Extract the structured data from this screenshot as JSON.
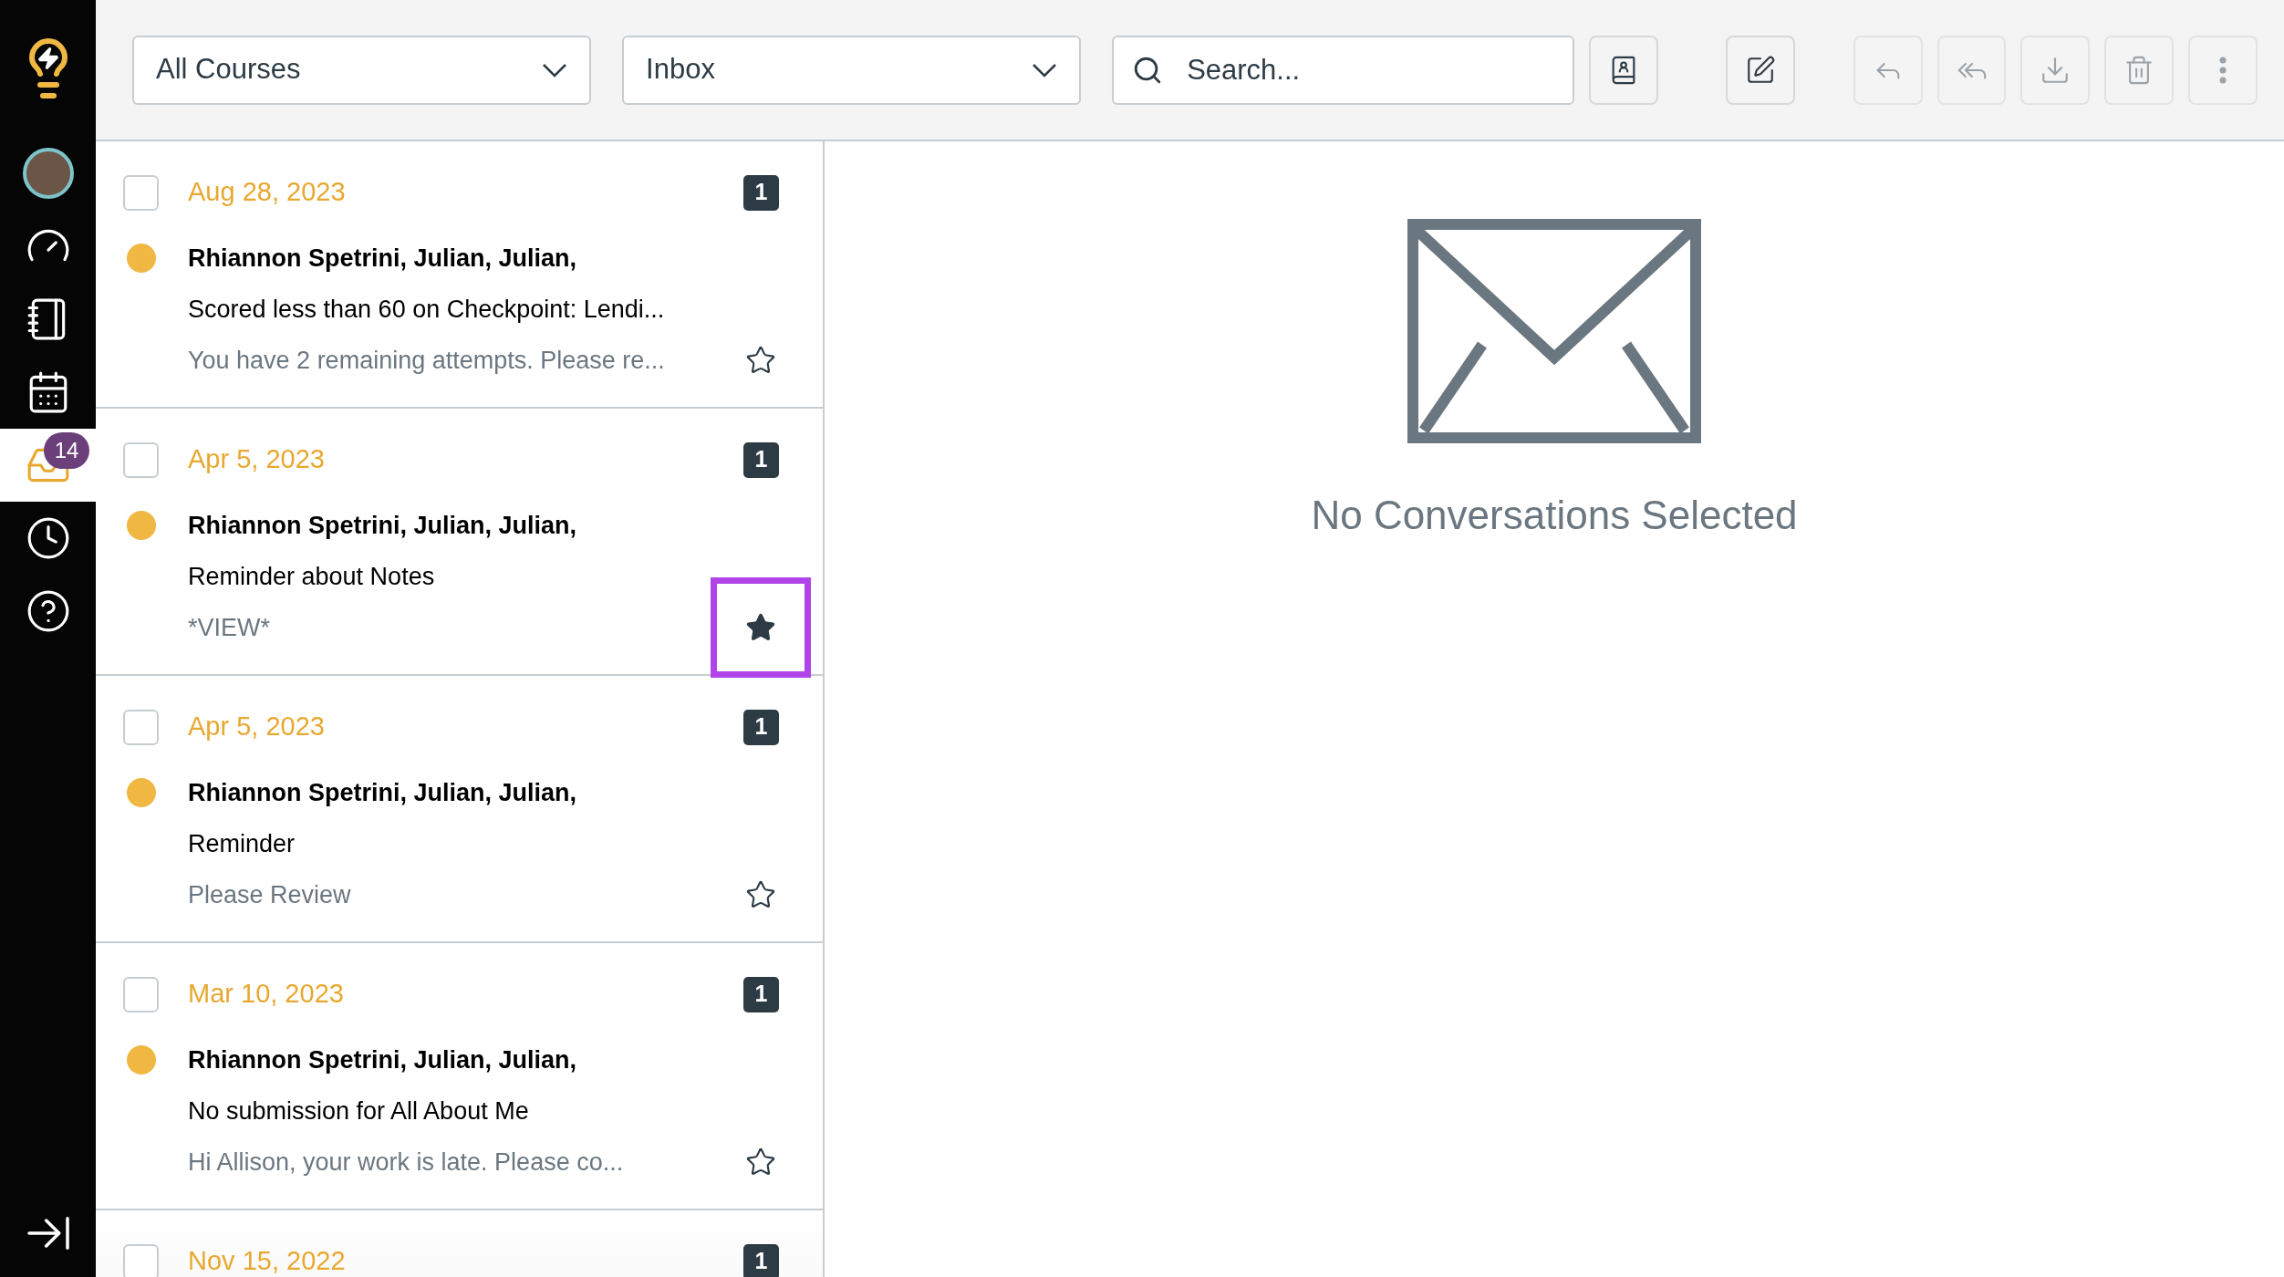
{
  "sidebar": {
    "items": [
      {
        "kind": "account",
        "selected": false
      },
      {
        "kind": "dashboard",
        "selected": false
      },
      {
        "kind": "courses",
        "selected": false
      },
      {
        "kind": "calendar",
        "selected": false
      },
      {
        "kind": "inbox",
        "selected": true,
        "badge": "14"
      },
      {
        "kind": "history",
        "selected": false
      },
      {
        "kind": "help",
        "selected": false
      }
    ]
  },
  "toolbar": {
    "course_filter": {
      "value": "All Courses"
    },
    "mailbox_filter": {
      "value": "Inbox"
    },
    "search": {
      "placeholder": "Search..."
    },
    "actions": [
      {
        "kind": "address_book",
        "disabled": false
      },
      {
        "kind": "compose",
        "disabled": false
      },
      {
        "kind": "reply",
        "disabled": true
      },
      {
        "kind": "reply_all",
        "disabled": true
      },
      {
        "kind": "archive",
        "disabled": true
      },
      {
        "kind": "delete",
        "disabled": true
      },
      {
        "kind": "more",
        "disabled": true
      }
    ]
  },
  "messages": [
    {
      "checked": false,
      "date": "Aug 28, 2023",
      "count": "1",
      "unread": true,
      "participants": "Rhiannon Spetrini, Julian, Julian,",
      "subject": "Scored less than 60 on Checkpoint: Lendi...",
      "preview": "You have 2 remaining attempts. Please re...",
      "starred": false,
      "highlighted": false
    },
    {
      "checked": false,
      "date": "Apr 5, 2023",
      "count": "1",
      "unread": true,
      "participants": "Rhiannon Spetrini, Julian, Julian,",
      "subject": "Reminder about Notes",
      "preview": "*VIEW*",
      "starred": true,
      "highlighted": true
    },
    {
      "checked": false,
      "date": "Apr 5, 2023",
      "count": "1",
      "unread": true,
      "participants": "Rhiannon Spetrini, Julian, Julian,",
      "subject": "Reminder",
      "preview": "Please Review",
      "starred": false,
      "highlighted": false
    },
    {
      "checked": false,
      "date": "Mar 10, 2023",
      "count": "1",
      "unread": true,
      "participants": "Rhiannon Spetrini, Julian, Julian,",
      "subject": "No submission for All About Me",
      "preview": "Hi Allison, your work is late. Please co...",
      "starred": false,
      "highlighted": false
    },
    {
      "checked": false,
      "date": "Nov 15, 2022",
      "count": "1"
    }
  ],
  "empty_state": {
    "message": "No Conversations Selected"
  }
}
